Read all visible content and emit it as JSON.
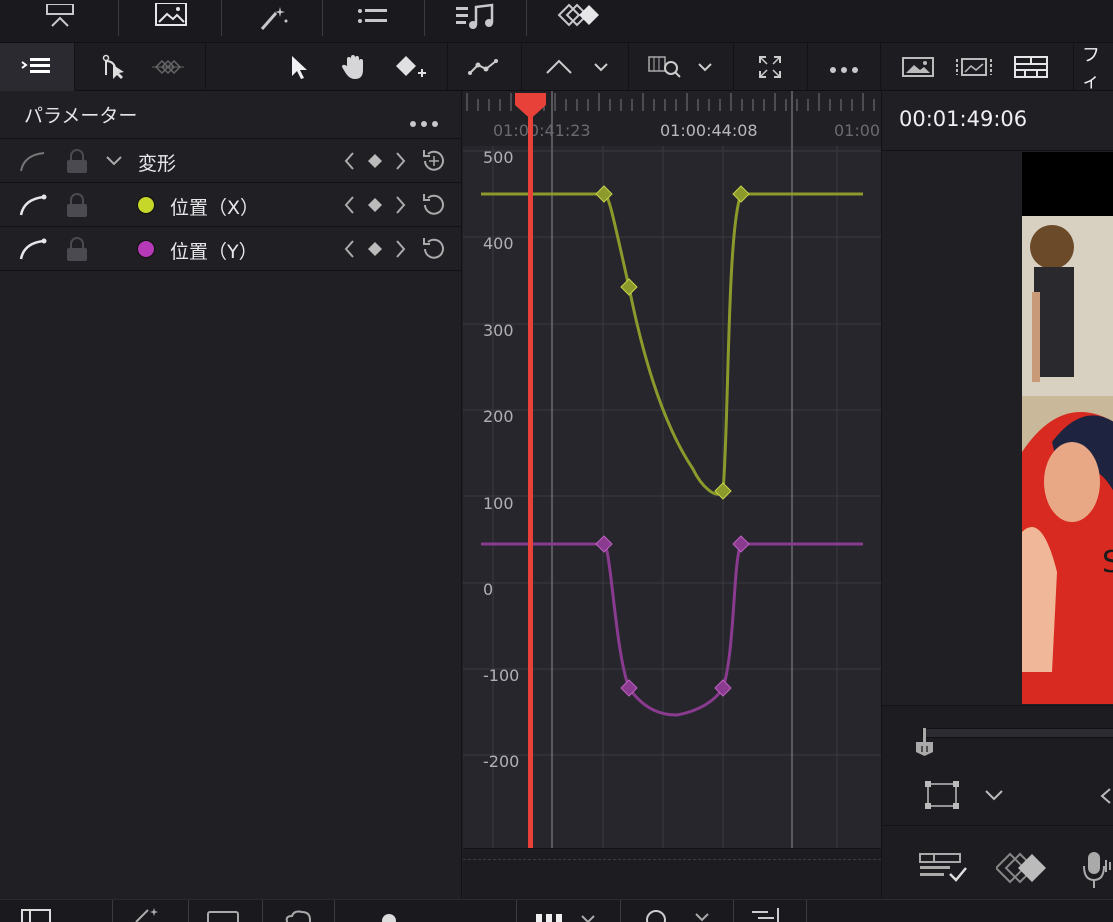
{
  "page_tabs": {
    "icons": [
      "cut-page-icon",
      "media-pool-icon",
      "effects-icon",
      "index-icon",
      "sound-library-icon",
      "keyframes-icon"
    ]
  },
  "toolbar": {
    "tools": [
      "toggle-panel-icon",
      "curve-select-icon",
      "ease-icon",
      "pointer-icon",
      "hand-icon",
      "add-keyframe-icon",
      "curve-snap-icon",
      "bezier-icon",
      "zoom-fit-icon",
      "expand-icon",
      "more-icon"
    ]
  },
  "parameters": {
    "title": "パラメーター",
    "rows": [
      {
        "label": "変形",
        "type": "group"
      },
      {
        "label": "位置（X）",
        "color": "#c6d72a"
      },
      {
        "label": "位置（Y）",
        "color": "#b63ab8"
      }
    ]
  },
  "graph": {
    "ruler_labels": [
      "01:00:41:23",
      "01:00:44:08",
      "01:00"
    ],
    "y_labels": [
      "500",
      "400",
      "300",
      "200",
      "100",
      "0",
      "-100",
      "-200"
    ],
    "playhead_color": "#e8413a",
    "curve_x_color": "#8c9a2c",
    "curve_y_color": "#8a3b8f"
  },
  "chart_data": {
    "type": "line",
    "ylim": [
      -290,
      510
    ],
    "series": [
      {
        "name": "位置（X）",
        "values": [
          460,
          460,
          352,
          114,
          460,
          460
        ]
      },
      {
        "name": "位置（Y）",
        "values": [
          55,
          55,
          -115,
          -115,
          55,
          55
        ]
      }
    ]
  },
  "viewer": {
    "timecode": "00:01:49:06",
    "tab_partial": "フィ"
  }
}
